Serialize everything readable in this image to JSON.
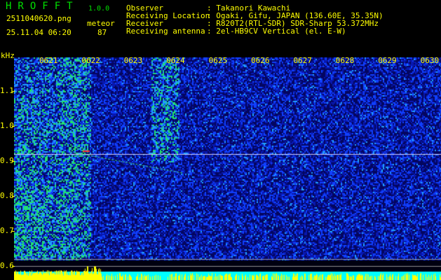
{
  "app": {
    "title": "HROFFT",
    "version": "1.0.0"
  },
  "file": {
    "name": "2511040620.png",
    "datetime": "25.11.04 06:20"
  },
  "meteor": {
    "label": "meteor",
    "count": "87"
  },
  "info": [
    {
      "label": "Observer",
      "value": ": Takanori Kawachi"
    },
    {
      "label": "Receiving Location",
      "value": ": Ogaki, Gifu, JAPAN (136.60E, 35.35N)"
    },
    {
      "label": "Receiver",
      "value": ": R820T2(RTL-SDR) SDR-Sharp 53.372MHz"
    },
    {
      "label": "Receiving antenna",
      "value": ": 2el-HB9CV Vertical (el. E-W)"
    }
  ],
  "chart_data": {
    "type": "heatmap",
    "ylabel": "kHz",
    "x_ticks": [
      "0621",
      "0622",
      "0623",
      "0624",
      "0625",
      "0626",
      "0627",
      "0628",
      "0629",
      "0630"
    ],
    "y_ticks": [
      "1.1",
      "1.0",
      "0.9",
      "0.8",
      "0.7",
      "0.6"
    ],
    "ylim": [
      0.57,
      1.2
    ],
    "carrier_line_khz": 0.92,
    "colors": {
      "text": "#ffff00",
      "title": "#00e000",
      "signal_bar": "#ffff00",
      "baseline": "#00ffff"
    }
  }
}
